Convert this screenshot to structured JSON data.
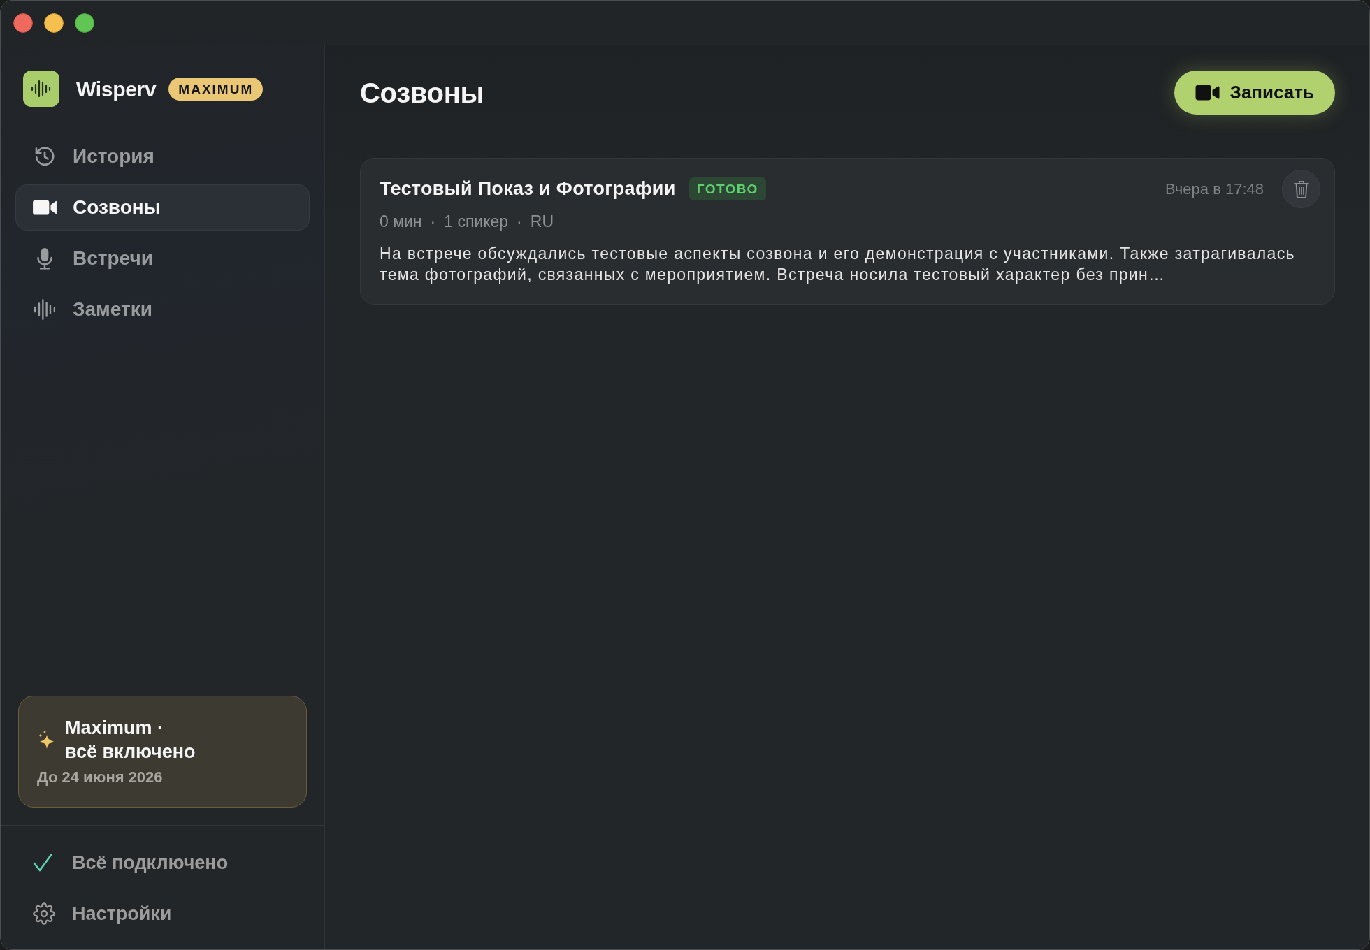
{
  "sidebar": {
    "app_name": "Wisperv",
    "plan_badge": "MAXIMUM",
    "nav": [
      {
        "label": "История",
        "selected": false
      },
      {
        "label": "Созвоны",
        "selected": true
      },
      {
        "label": "Встречи",
        "selected": false
      },
      {
        "label": "Заметки",
        "selected": false
      }
    ],
    "plan_card": {
      "title": "Maximum ·\nвсё включено",
      "subtitle": "До 24 июня 2026"
    },
    "footer": [
      {
        "kind": "status",
        "label": "Всё подключено"
      },
      {
        "kind": "link",
        "label": "Настройки"
      }
    ]
  },
  "main": {
    "title": "Созвоны",
    "record_button": "Записать",
    "calls": [
      {
        "title": "Тестовый Показ и Фотографии",
        "status": "ГОТОВО",
        "time": "Вчера в 17:48",
        "meta": [
          "0 мин",
          "·",
          "1 спикер",
          "·",
          "RU"
        ],
        "summary": "На встрече обсуждались тестовые аспекты созвона и его демонстрация с участниками. Также затрагивалась тема фотографий, связанных с мероприятием. Встреча носила тестовый характер без прин…"
      }
    ]
  }
}
